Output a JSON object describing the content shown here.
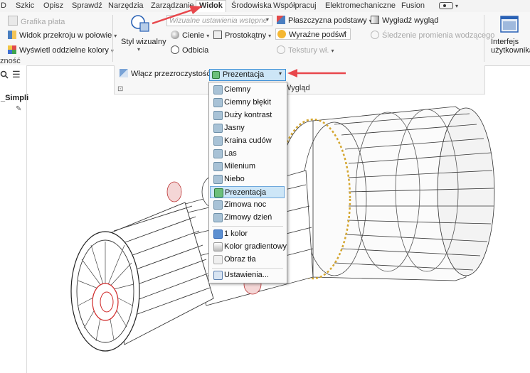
{
  "tabs": [
    "D",
    "Szkic",
    "Opisz",
    "Sprawdź",
    "Narzędzia",
    "Zarządzanie",
    "Widok",
    "Środowiska",
    "Współpracuj",
    "Elektromechaniczne",
    "Fusion"
  ],
  "ribbon": {
    "grafika_plata": "Grafika płata",
    "widok_przekroju": "Widok przekroju w połowie",
    "wyswietl_kolory": "Wyświetl oddzielne kolory",
    "widocznosc": "zność",
    "styl_wizualny": "Styl wizualny",
    "wizualne_ustawienia": "Wizualne ustawienia wstępne",
    "cienie": "Cienie",
    "prostokatny": "Prostokątny",
    "odbicia": "Odbicia",
    "plaszczyzna": "Płaszczyzna podstawy",
    "wyrazne": "Wyraźne podświ",
    "tekstury": "Tekstury wł.",
    "wygladz": "Wygładź wygląd",
    "sledzenie": "Śledzenie promienia wodzącego",
    "interfejs_1": "Interfejs",
    "interfejs_2": "użytkownika",
    "wlacz_przezroczystosc": "Włącz przezroczystość",
    "wyglad": "Wygląd",
    "combo_value": "Prezentacja"
  },
  "left_panel": {
    "simpli": "_Simpli"
  },
  "dropdown": {
    "items": [
      "Ciemny",
      "Ciemny błękit",
      "Duży kontrast",
      "Jasny",
      "Kraina cudów",
      "Las",
      "Milenium",
      "Niebo",
      "Prezentacja",
      "Zimowa noc",
      "Zimowy dzień"
    ],
    "selected": "Prezentacja",
    "items2": [
      "1 kolor",
      "Kolor gradientowy",
      "Obraz tła"
    ],
    "settings": "Ustawienia..."
  },
  "colors": {
    "accent_red": "#e8474c",
    "highlight": "#cde6f7",
    "highlight_border": "#3c8fd6"
  }
}
